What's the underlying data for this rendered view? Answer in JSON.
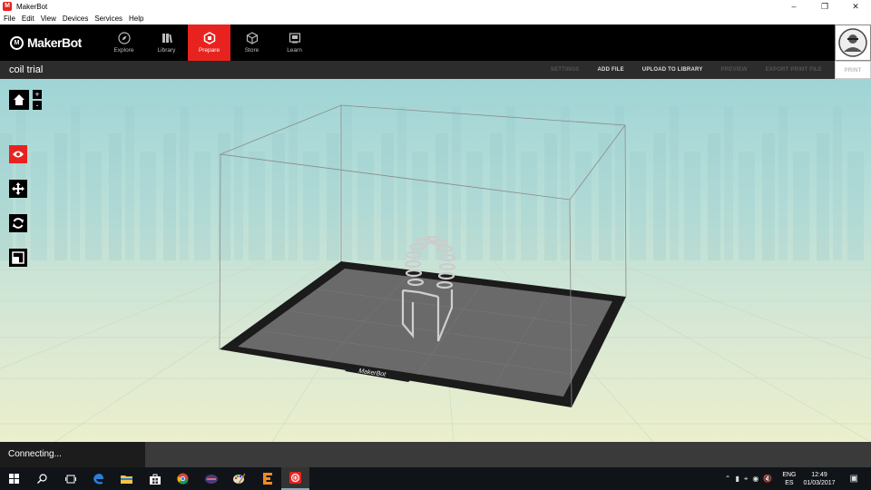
{
  "window": {
    "title": "MakerBot",
    "app_icon": "makerbot-app-icon"
  },
  "menu": [
    "File",
    "Edit",
    "View",
    "Devices",
    "Services",
    "Help"
  ],
  "brand": {
    "name": "MakerBot",
    "logo_glyph": "M"
  },
  "nav_tabs": [
    {
      "label": "Explore",
      "icon": "compass-icon"
    },
    {
      "label": "Library",
      "icon": "library-icon"
    },
    {
      "label": "Prepare",
      "icon": "prepare-icon",
      "active": true
    },
    {
      "label": "Store",
      "icon": "cube-icon"
    },
    {
      "label": "Learn",
      "icon": "learn-icon"
    }
  ],
  "project": {
    "title": "coil trial"
  },
  "actions": [
    {
      "label": "SETTINGS",
      "enabled": false
    },
    {
      "label": "ADD FILE",
      "enabled": true
    },
    {
      "label": "UPLOAD TO LIBRARY",
      "enabled": true
    },
    {
      "label": "PREVIEW",
      "enabled": false
    },
    {
      "label": "EXPORT PRINT FILE",
      "enabled": false
    },
    {
      "label": "PRINT",
      "enabled": false
    }
  ],
  "tools": {
    "zoom_in": "+",
    "zoom_out": "-",
    "items": [
      "home-view-icon",
      "eye-icon",
      "move-icon",
      "rotate-icon",
      "scale-icon"
    ]
  },
  "build_plate": {
    "label": "MakerBot"
  },
  "status": {
    "text": "Connecting..."
  },
  "taskbar": {
    "icons": [
      "windows-start-icon",
      "search-icon",
      "task-view-icon",
      "edge-icon",
      "file-explorer-icon",
      "store-icon",
      "chrome-icon",
      "media-icon",
      "paint-icon",
      "e-app-icon",
      "makerbot-taskbar-icon"
    ],
    "lang_top": "ENG",
    "lang_bottom": "ES",
    "time": "12:49",
    "date": "01/03/2017"
  },
  "colors": {
    "accent": "#e8231f",
    "nav_bg": "#000000",
    "viewport_top": "#9fd4d6",
    "viewport_bottom": "#ebefcc"
  }
}
